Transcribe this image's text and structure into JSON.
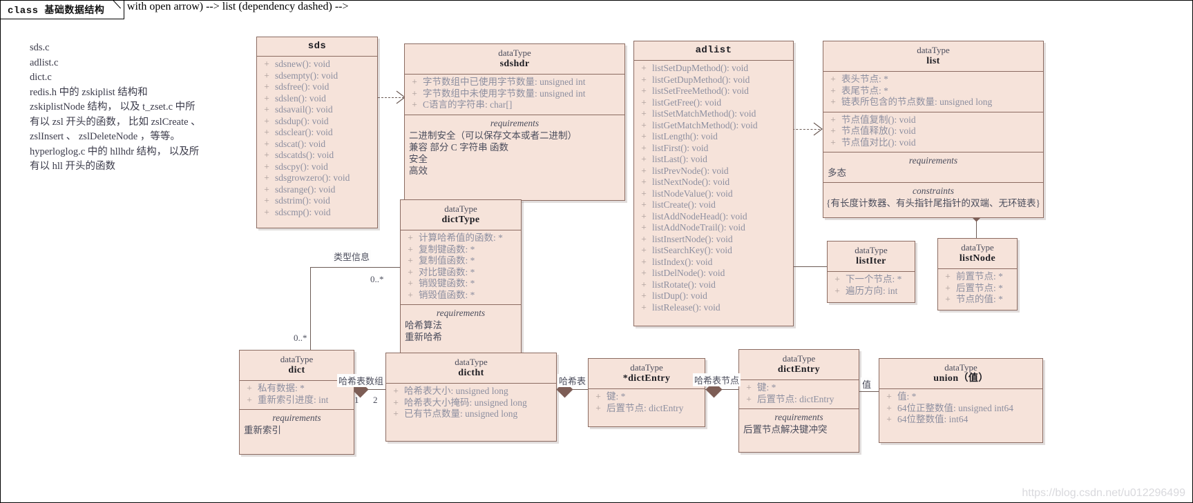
{
  "frame": {
    "keyword": "class",
    "title": "基础数据结构",
    "label": "class 基础数据结构"
  },
  "note": {
    "text": "sds.c\nadlist.c\ndict.c\nredis.h 中的 zskiplist 结构和\nzskiplistNode 结构， 以及 t_zset.c 中所\n有以 zsl 开头的函数， 比如 zslCreate 、\nzslInsert 、 zslDeleteNode ，等等。\nhyperloglog.c 中的 hllhdr 结构， 以及所\n有以 hll 开头的函数"
  },
  "classes": {
    "sds": {
      "stereotype": "",
      "name": "sds",
      "methods": [
        "sdsnew(): void",
        "sdsempty(): void",
        "sdsfree(): void",
        "sdslen(): void",
        "sdsavail(): void",
        "sdsdup(): void",
        "sdsclear(): void",
        "sdscat(): void",
        "sdscatds(): void",
        "sdscpy(): void",
        "sdsgrowzero(): void",
        "sdsrange(): void",
        "sdstrim(): void",
        "sdscmp(): void"
      ]
    },
    "sdshdr": {
      "stereotype": "dataType",
      "name": "sdshdr",
      "attributes": [
        "字节数组中已使用字节数量: unsigned int",
        "字节数组中未使用字节数量: unsigned int",
        "C语言的字符串: char[]"
      ],
      "requirements_title": "requirements",
      "requirements": [
        "二进制安全（可以保存文本或者二进制）",
        "兼容 部分 C 字符串 函数",
        "安全",
        "高效"
      ]
    },
    "adlist": {
      "stereotype": "",
      "name": "adlist",
      "methods": [
        "listSetDupMethod(): void",
        "listGetDupMethod(): void",
        "listSetFreeMethod(): void",
        "listGetFree(): void",
        "listSetMatchMethod(): void",
        "listGetMatchMethod(): void",
        "listLength(): void",
        "listFirst(): void",
        "listLast(): void",
        "listPrevNode(): void",
        "listNextNode(): void",
        "listNodeValue(): void",
        "listCreate(): void",
        "listAddNodeHead(): void",
        "listAddNodeTrail(): void",
        "listInsertNode(): void",
        "listSearchKey(): void",
        "listIndex(): void",
        "listDelNode(): void",
        "listRotate(): void",
        "listDup(): void",
        "listRelease(): void"
      ]
    },
    "list": {
      "stereotype": "dataType",
      "name": "list",
      "attributes": [
        "表头节点: *",
        "表尾节点: *",
        "链表所包含的节点数量: unsigned  long"
      ],
      "methods": [
        "节点值复制(): void",
        "节点值释放(): void",
        "节点值对比(): void"
      ],
      "requirements_title": "requirements",
      "requirements": [
        "多态"
      ],
      "constraints_title": "constraints",
      "constraints": [
        "{有长度计数器、有头指针尾指针的双端、无环链表}"
      ]
    },
    "dictType": {
      "stereotype": "dataType",
      "name": "dictType",
      "attributes": [
        "计算哈希值的函数: *",
        "复制键函数: *",
        "复制值函数: *",
        "对比键函数: *",
        "销毁键函数: *",
        "销毁值函数: *"
      ],
      "requirements_title": "requirements",
      "requirements": [
        "哈希算法",
        "重新哈希"
      ]
    },
    "listIter": {
      "stereotype": "dataType",
      "name": "listIter",
      "attributes": [
        "下一个节点: *",
        "遍历方向: int"
      ]
    },
    "listNode": {
      "stereotype": "dataType",
      "name": "listNode",
      "attributes": [
        "前置节点: *",
        "后置节点: *",
        "节点的值: *"
      ]
    },
    "dict": {
      "stereotype": "dataType",
      "name": "dict",
      "attributes": [
        "私有数据: *",
        "重新索引进度: int"
      ],
      "requirements_title": "requirements",
      "requirements": [
        "重新索引"
      ]
    },
    "dictht": {
      "stereotype": "dataType",
      "name": "dictht",
      "attributes": [
        "哈希表大小: unsigned long",
        "哈希表大小掩码: unsigned long",
        "已有节点数量: unsigned long"
      ]
    },
    "dictEntryPtr": {
      "stereotype": "dataType",
      "name": "*dictEntry",
      "attributes": [
        "键: *",
        "后置节点: dictEntry"
      ]
    },
    "dictEntry": {
      "stereotype": "dataType",
      "name": "dictEntry",
      "attributes": [
        "键: *",
        "后置节点: dictEntry"
      ],
      "requirements_title": "requirements",
      "requirements": [
        "后置节点解决键冲突"
      ]
    },
    "union": {
      "stereotype": "dataType",
      "name": "union（值）",
      "attributes": [
        "值: *",
        "64位正整数值: unsigned int64",
        "64位整数值: int64"
      ]
    }
  },
  "edges": {
    "type_info_label": "类型信息",
    "dict_dictht_label": "哈希表数组",
    "dict_mult_1": "1",
    "dict_mult_2": "2",
    "dictht_entry_label": "哈希表",
    "entry_node_label": "哈希表节点",
    "entry_union_label": "值",
    "dicttype_mult_top": "0..*",
    "dicttype_mult_bottom": "0..*"
  },
  "visibility": {
    "public": "+"
  },
  "watermark": "https://blog.csdn.net/u012296499",
  "colors": {
    "box_fill": "#f6e3da",
    "box_border": "#8a6a60",
    "member_text": "#8d8fa0",
    "title_text": "#1c1c22",
    "connector": "#6b5a54",
    "diamond": "#7d5d55"
  }
}
